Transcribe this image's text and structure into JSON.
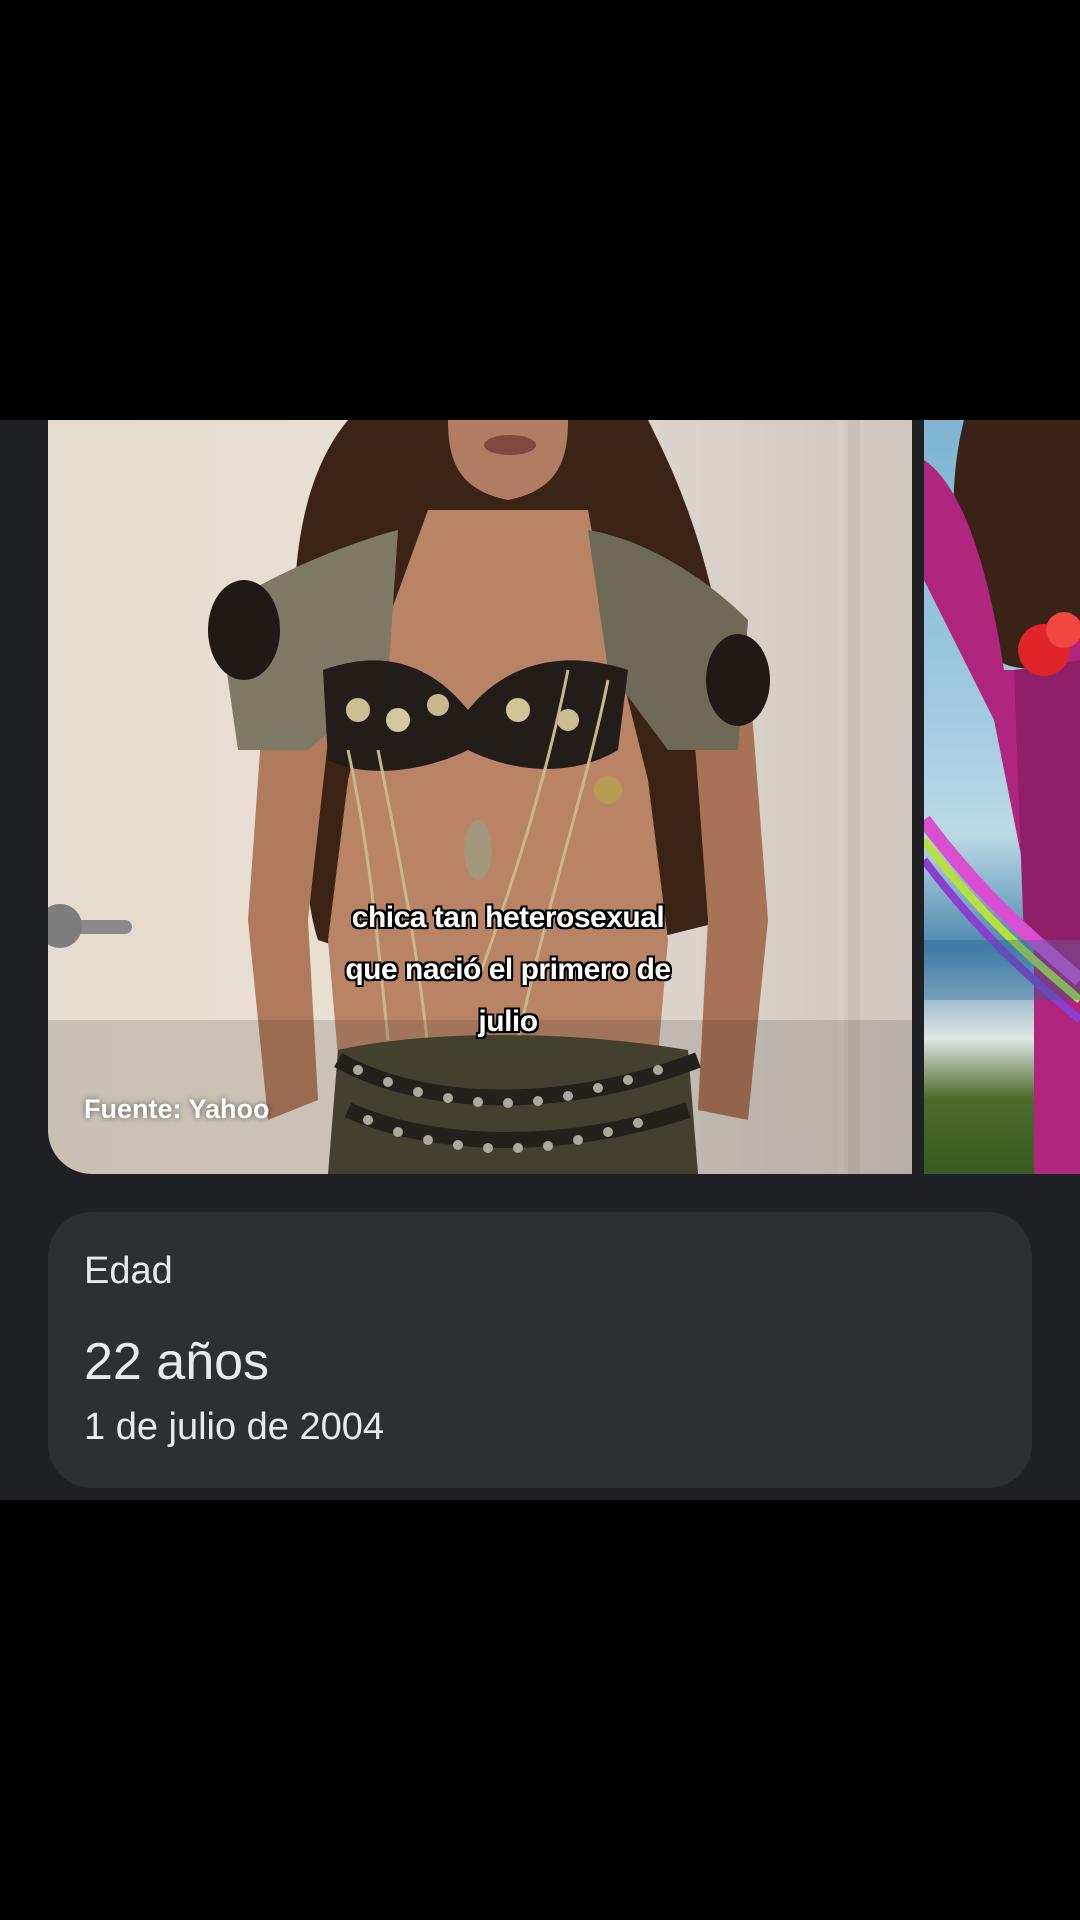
{
  "knowledge_panel": {
    "images": {
      "main_caption": "chica tan heterosexual\nque nació el primero de\njulio",
      "source": "Fuente: Yahoo"
    },
    "age_card": {
      "label": "Edad",
      "value": "22 años",
      "birth_date": "1 de julio de 2004"
    }
  },
  "colors": {
    "panel_background": "#202124",
    "card_background": "#2d2f33",
    "text_primary": "#e8eaed"
  }
}
